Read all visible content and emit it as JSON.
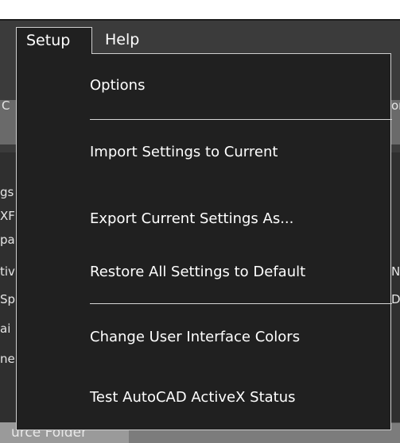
{
  "menubar": {
    "items": [
      {
        "label": "Setup",
        "open": true
      },
      {
        "label": "Help",
        "open": false
      }
    ]
  },
  "setup_menu": {
    "items": [
      {
        "label": "Options"
      },
      {
        "label": "Import Settings to Current"
      },
      {
        "label": "Export Current Settings As..."
      },
      {
        "label": "Restore All Settings to Default"
      },
      {
        "label": "Change User Interface Colors"
      },
      {
        "label": "Test AutoCAD ActiveX Status"
      }
    ]
  },
  "background": {
    "fragments": [
      "gs",
      "XF",
      "pa",
      "tiv",
      "Sp",
      "ai",
      "ne",
      "C",
      "or",
      "Na",
      "D"
    ],
    "bottom_tab_label": "urce Folder"
  },
  "colors": {
    "menu_background": "#202020",
    "menu_border": "#cfcfcf",
    "menu_text": "#ffffff",
    "app_background": "#3b3b3b"
  }
}
